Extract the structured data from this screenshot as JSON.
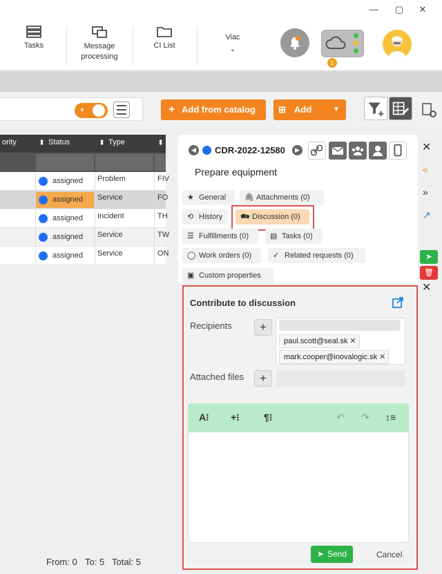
{
  "window": {
    "minimize": "—",
    "maximize": "▢",
    "close": "✕"
  },
  "topbar": {
    "items": [
      {
        "label": "Tasks",
        "icon": "tasks-icon"
      },
      {
        "label": "Message processing",
        "icon": "message-processing-icon"
      },
      {
        "label": "CI List",
        "icon": "folder-icon"
      },
      {
        "label": "Viac",
        "icon": "chevron-down-icon"
      }
    ],
    "cloud_badge": "1"
  },
  "toolbar": {
    "add_from_catalog": "Add from catalog",
    "add": "Add"
  },
  "grid": {
    "headers": {
      "priority": "ority",
      "status": "Status",
      "type": "Type"
    },
    "rows": [
      {
        "status": "assigned",
        "type": "Problem",
        "extra": "FIV",
        "highlight": false
      },
      {
        "status": "assigned",
        "type": "Service",
        "extra": "FO",
        "highlight": true
      },
      {
        "status": "assigned",
        "type": "Incident",
        "extra": "TH",
        "highlight": false
      },
      {
        "status": "assigned",
        "type": "Service",
        "extra": "TW",
        "highlight": false
      },
      {
        "status": "assigned",
        "type": "Service",
        "extra": "ON",
        "highlight": false
      }
    ],
    "footer": {
      "from": "From: 0",
      "to": "To: 5",
      "total": "Total: 5"
    }
  },
  "record": {
    "id": "CDR-2022-12580",
    "title": "Prepare equipment",
    "tabs": [
      {
        "label": "General",
        "icon": "star-icon"
      },
      {
        "label": "Attachments (0)",
        "icon": "paperclip-icon"
      },
      {
        "label": "History",
        "icon": "history-icon"
      },
      {
        "label": "Discussion (0)",
        "icon": "discussion-icon"
      },
      {
        "label": "Fulfillments (0)",
        "icon": "list-icon"
      },
      {
        "label": "Tasks (0)",
        "icon": "tasks-icon"
      },
      {
        "label": "Work orders (0)",
        "icon": "comment-icon"
      },
      {
        "label": "Related requests (0)",
        "icon": "check-circle-icon"
      },
      {
        "label": "Custom properties",
        "icon": "properties-icon"
      }
    ]
  },
  "discussion": {
    "title": "Contribute to discussion",
    "recipients_label": "Recipients",
    "recipients": [
      "paul.scott@seal.sk",
      "mark.cooper@inovalogic.sk"
    ],
    "attached_files_label": "Attached files",
    "editor_tools": [
      "A⁝",
      "+⁝",
      "¶⁝"
    ],
    "send": "Send",
    "cancel": "Cancel"
  },
  "colors": {
    "accent_orange": "#f4841f",
    "status_blue": "#1e6ff0",
    "send_green": "#2db24a",
    "highlight_red": "#d9534f",
    "editor_bar": "#b9ebc9"
  }
}
